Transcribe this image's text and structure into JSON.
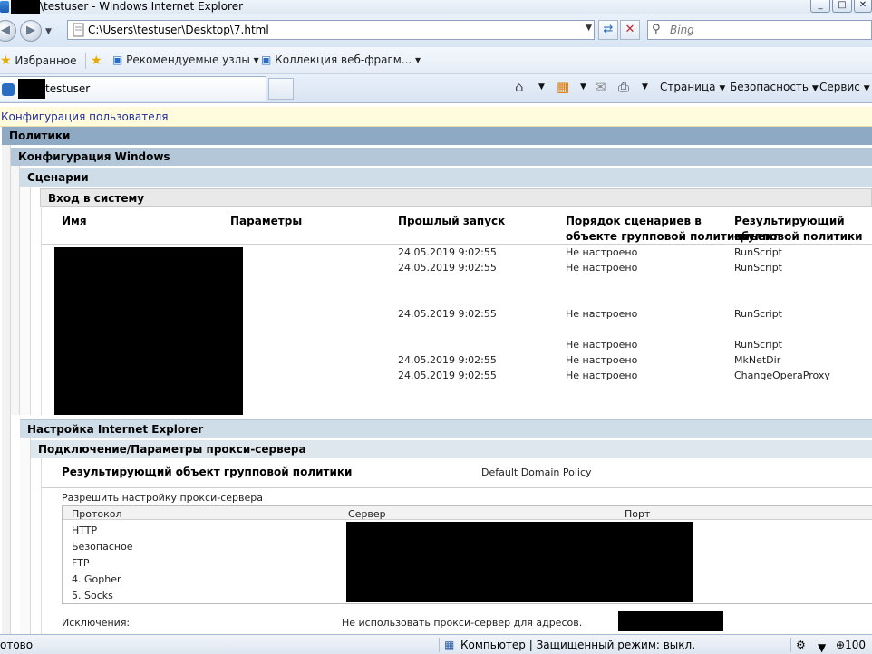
{
  "window": {
    "title": "\\testuser - Windows Internet Explorer",
    "controls": [
      "_",
      "□",
      "✕"
    ]
  },
  "address_bar": {
    "url": "C:\\Users\\testuser\\Desktop\\7.html",
    "search_placeholder": "Bing"
  },
  "favorites_bar": {
    "favorites_label": "Избранное",
    "items": [
      "Рекомендуемые узлы ▾",
      "Коллекция веб-фрагм... ▾"
    ]
  },
  "tab": {
    "title": "testuser"
  },
  "command_bar": {
    "page": "Страница",
    "safety": "Безопасность",
    "tools": "Сервис"
  },
  "report": {
    "header": "Конфигурация пользователя",
    "policies": "Политики",
    "windows_config": "Конфигурация Windows",
    "scripts": "Сценарии",
    "logon": "Вход в систему",
    "columns": {
      "name": "Имя",
      "params": "Параметры",
      "last_run": "Прошлый запуск",
      "order_l1": "Порядок сценариев в",
      "order_l2": "объекте групповой политики",
      "gpo_l1": "Результирующий объект",
      "gpo_l2": "групповой политики"
    },
    "script_rows": [
      {
        "last_run": "24.05.2019 9:02:55",
        "order": "Не настроено",
        "gpo": "RunScript"
      },
      {
        "last_run": "24.05.2019 9:02:55",
        "order": "Не настроено",
        "gpo": "RunScript"
      },
      {
        "last_run": "24.05.2019 9:02:55",
        "order": "Не настроено",
        "gpo": "RunScript"
      },
      {
        "last_run": "",
        "order": "Не настроено",
        "gpo": "RunScript"
      },
      {
        "last_run": "24.05.2019 9:02:55",
        "order": "Не настроено",
        "gpo": "MkNetDir"
      },
      {
        "last_run": "24.05.2019 9:02:55",
        "order": "Не настроено",
        "gpo": "ChangeOperaProxy"
      }
    ],
    "ie_settings": "Настройка Internet Explorer",
    "proxy_section": "Подключение/Параметры прокси-сервера",
    "gpo_label": "Результирующий объект групповой политики",
    "gpo_value": "Default Domain Policy",
    "allow_proxy": "Разрешить настройку прокси-сервера",
    "proxy_columns": {
      "protocol": "Протокол",
      "server": "Сервер",
      "port": "Порт"
    },
    "protocols": [
      "HTTP",
      "Безопасное",
      "FTP",
      "4. Gopher",
      "5. Socks"
    ],
    "exceptions_label": "Исключения:",
    "exceptions_value": "Не использовать прокси-сервер для адресов."
  },
  "status_bar": {
    "left": "отово",
    "zone": "Компьютер | Защищенный режим: выкл.",
    "zoom": "100"
  }
}
